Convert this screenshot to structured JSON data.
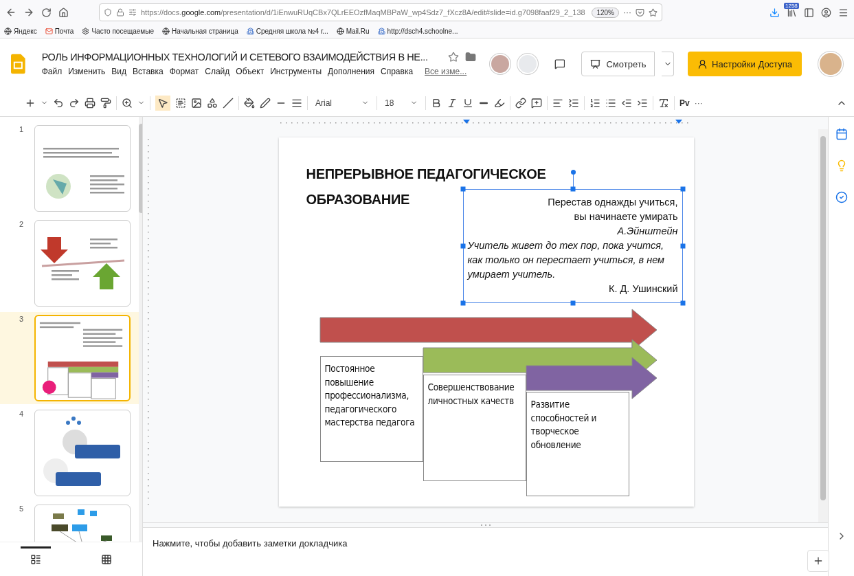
{
  "browser": {
    "url_prefix": "https://docs.",
    "url_domain": "google.com",
    "url_rest": "/presentation/d/1iEnwuRUqCBx7QLrEEOzfMaqMBPaW_wp4Sdz7_fXcz8A/edit#slide=id.g7098faaf29_2_138",
    "zoom": "120%",
    "more": "···",
    "library_badge": "1258"
  },
  "bookmarks": [
    {
      "label": "Яндекс",
      "kind": "globe"
    },
    {
      "label": "Почта",
      "kind": "mail"
    },
    {
      "label": "Часто посещаемые",
      "kind": "gear"
    },
    {
      "label": "Начальная страница",
      "kind": "globe"
    },
    {
      "label": "Средняя школа №4 г...",
      "kind": "site"
    },
    {
      "label": "Mail.Ru",
      "kind": "globe"
    },
    {
      "label": "http://dsch4.schoolne...",
      "kind": "site"
    }
  ],
  "doc": {
    "title": "РОЛЬ ИНФОРМАЦИОННЫХ ТЕХНОЛОГИЙ И СЕТЕВОГО ВЗАИМОДЕЙСТВИЯ В НЕ...",
    "menus": [
      "Файл",
      "Изменить",
      "Вид",
      "Вставка",
      "Формат",
      "Слайд",
      "Объект",
      "Инструменты",
      "Дополнения",
      "Справка"
    ],
    "all_changes": "Все изме...",
    "present": "Смотреть",
    "share": "Настройки Доступа"
  },
  "toolbar": {
    "font": "Arial",
    "size": "18",
    "input_tools": "Pv",
    "more": "···"
  },
  "slides": [
    {
      "number": "1",
      "selected": false,
      "kind": "title"
    },
    {
      "number": "2",
      "selected": false,
      "kind": "arrows"
    },
    {
      "number": "3",
      "selected": true,
      "kind": "stages"
    },
    {
      "number": "4",
      "selected": false,
      "kind": "network"
    },
    {
      "number": "5",
      "selected": false,
      "kind": "mindmap"
    }
  ],
  "slide": {
    "title": [
      "НЕПРЕРЫВНОЕ ПЕДАГОГИЧЕСКОЕ",
      "ОБРАЗОВАНИЕ"
    ],
    "quote": [
      {
        "text": "Перестав однажды учиться,",
        "italic": false,
        "kind": "epigraph"
      },
      {
        "text": "вы начинаете умирать",
        "italic": false,
        "kind": "epigraph"
      },
      {
        "text": "А.Эйнштейн",
        "italic": true,
        "kind": "signature"
      },
      {
        "text": "Учитель живет до тех пор, пока учится, как только он перестает учиться, в нем умирает учитель.",
        "italic": true,
        "kind": "paragraph"
      },
      {
        "text": "К. Д. Ушинский",
        "italic": false,
        "kind": "signature"
      }
    ],
    "stages": [
      {
        "text": "Постоянное повышение профессионализма, педагогического мастерства педагога",
        "color": "#c0504d"
      },
      {
        "text": "Совершенствование личностных качеств",
        "color": "#9bbb59"
      },
      {
        "text": "Развитие способностей и творческое обновление",
        "color": "#8064a2"
      }
    ]
  },
  "notes": {
    "placeholder": "Нажмите, чтобы добавить заметки докладчика"
  },
  "views": [
    {
      "kind": "filmstrip",
      "selected": true
    },
    {
      "kind": "grid",
      "selected": false
    }
  ]
}
